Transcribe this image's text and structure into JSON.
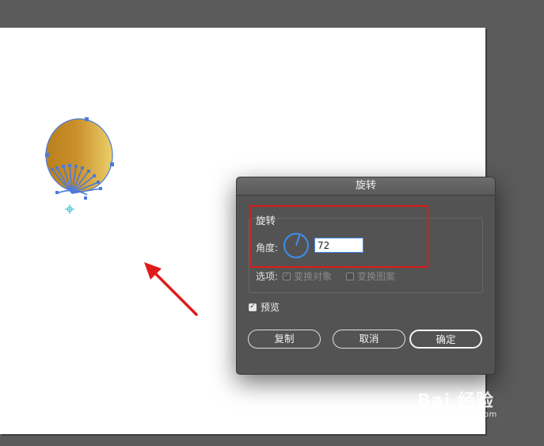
{
  "dialog": {
    "title": "旋转",
    "group_title": "旋转",
    "angle_label": "角度:",
    "angle_value": "72",
    "options_label": "选项:",
    "option_transform_objects": "变换对象",
    "option_transform_patterns": "变换图案",
    "option_transform_objects_checked": true,
    "option_transform_patterns_checked": false,
    "preview_label": "预览",
    "preview_checked": true,
    "copy_button": "复制",
    "cancel_button": "取消",
    "ok_button": "确定"
  },
  "annotations": {
    "highlight_color": "#e01a1a",
    "arrow_color": "#e01a1a"
  },
  "watermark": {
    "main": "Bai 经验",
    "sub": "jingyan.baidu.com"
  },
  "colors": {
    "canvas_bg": "#5b5b5b",
    "artboard": "#ffffff",
    "dialog_bg": "#535353",
    "selection_blue": "#4b7bdc",
    "gold_light": "#e8c25a",
    "gold_dark": "#b8801e"
  }
}
